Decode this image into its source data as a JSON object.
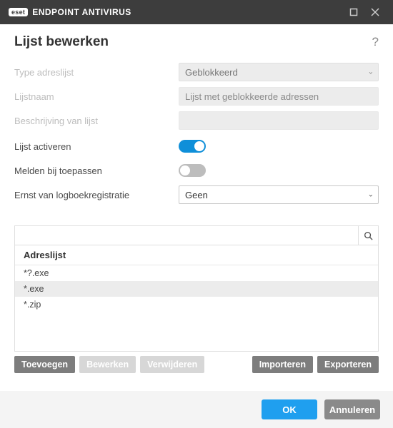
{
  "titlebar": {
    "brand_badge": "eset",
    "brand_text": "ENDPOINT ANTIVIRUS"
  },
  "heading": "Lijst bewerken",
  "labels": {
    "type": "Type adreslijst",
    "name": "Lijstnaam",
    "desc": "Beschrijving van lijst",
    "activate": "Lijst activeren",
    "notify": "Melden bij toepassen",
    "severity": "Ernst van logboekregistratie"
  },
  "values": {
    "type": "Geblokkeerd",
    "name": "Lijst met geblokkeerde adressen",
    "desc": "",
    "severity": "Geen"
  },
  "list": {
    "header": "Adreslijst",
    "rows": [
      "*?.exe",
      "*.exe",
      "*.zip"
    ],
    "selected_index": 1
  },
  "buttons": {
    "add": "Toevoegen",
    "edit": "Bewerken",
    "delete": "Verwijderen",
    "import": "Importeren",
    "export": "Exporteren",
    "ok": "OK",
    "cancel": "Annuleren"
  }
}
